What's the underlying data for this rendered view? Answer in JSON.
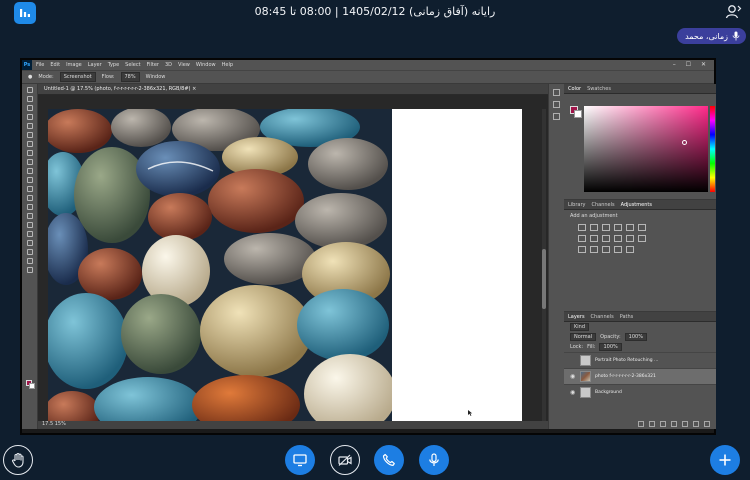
{
  "header": {
    "session_title": "رایانه (آفاق زمانی) 1405/02/12 | 08:00 تا 08:45",
    "user_name": "زمانی، محمد"
  },
  "photoshop": {
    "logo": "Ps",
    "menu": [
      "File",
      "Edit",
      "Image",
      "Layer",
      "Type",
      "Select",
      "Filter",
      "3D",
      "View",
      "Window",
      "Help"
    ],
    "options": {
      "mode_label": "Mode:",
      "mode_value": "Screenshot",
      "flow_label": "Flow:",
      "flow_value": "78%",
      "window_label": "Window"
    },
    "document_tab": "Untitled-1 @ 17.5% (photo, f-r-r-r-r-r-r-2-386x321, RGB/8#) ×",
    "status_text": "17.5 15%",
    "color_tabs": [
      "Color",
      "Swatches"
    ],
    "adj_tabs": [
      "Library",
      "Channels",
      "Adjustments"
    ],
    "adj_title": "Add an adjustment",
    "layers_tabs": [
      "Layers",
      "Channels",
      "Paths"
    ],
    "layers_kind": "Kind",
    "blend_mode": "Normal",
    "opacity_label": "Opacity:",
    "opacity_value": "100%",
    "lock_label": "Lock:",
    "fill_label": "Fill:",
    "fill_value": "100%",
    "layers": [
      {
        "name": "Portrait Photo Retouching ...",
        "selected": false
      },
      {
        "name": "photo f-r-r-r-r-r-r-2-386x321",
        "selected": true
      },
      {
        "name": "Background",
        "selected": false
      }
    ],
    "fg_color": "#a0154a",
    "bg_color": "#ffffff"
  },
  "controls": {
    "raise_hand": "hand-icon",
    "share_screen": "screen-share-icon",
    "camera": "camera-off-icon",
    "phone": "phone-icon",
    "mic": "mic-icon",
    "add": "plus-icon"
  },
  "colors": {
    "accent": "#1d7ee3",
    "background": "#0f1e2e",
    "user_badge": "#3b3f9c"
  }
}
